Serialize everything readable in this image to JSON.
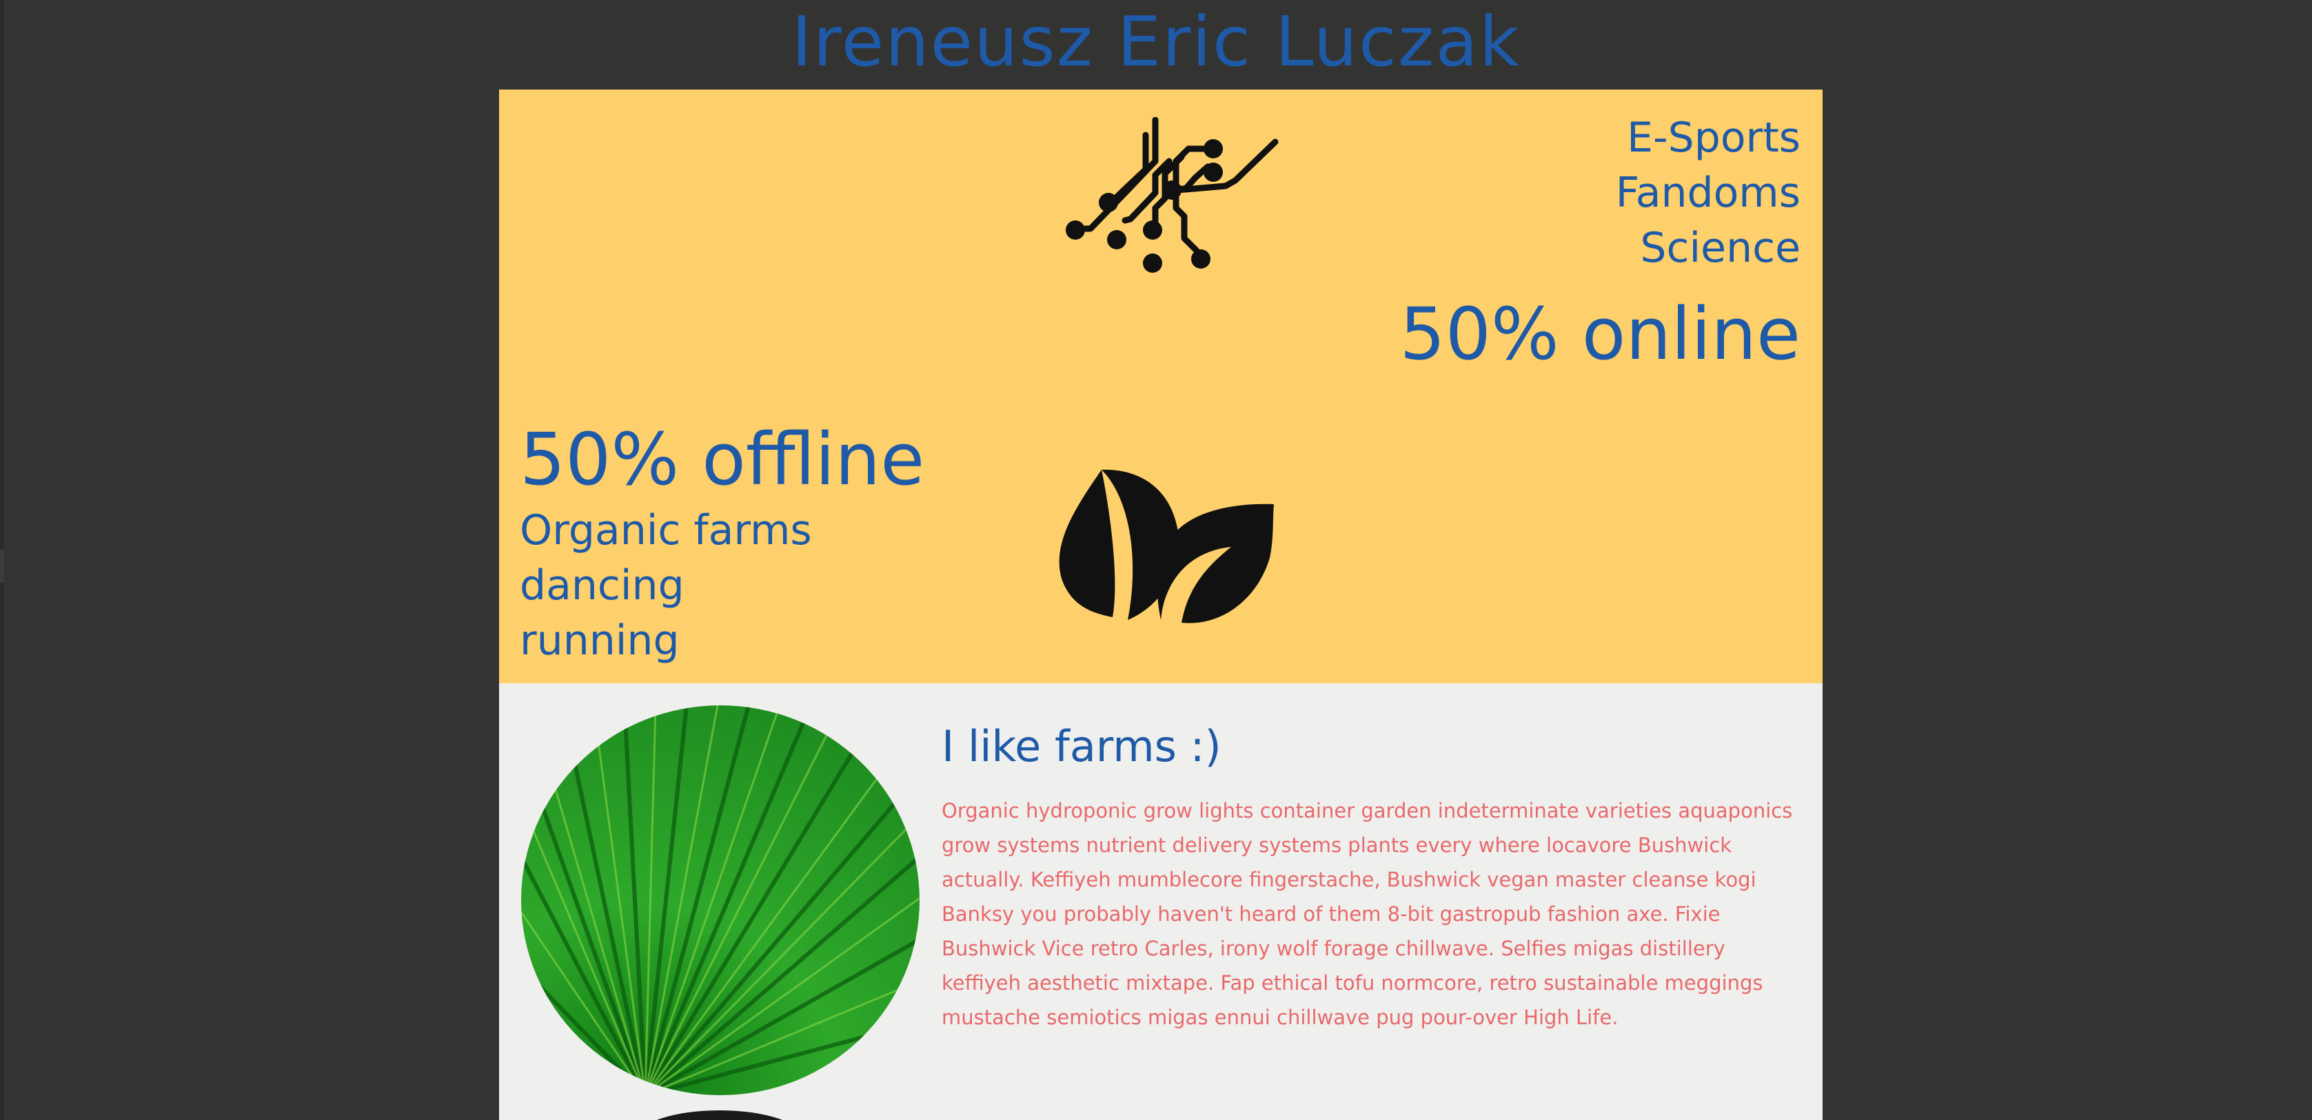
{
  "header": {
    "name": "Ireneusz Eric Luczak"
  },
  "hero": {
    "online": {
      "interests": [
        "E-Sports",
        "Fandoms",
        "Science"
      ],
      "stat": "50% online",
      "icon": "circuit-icon"
    },
    "offline": {
      "stat": "50% offline",
      "interests": [
        "Organic farms",
        "dancing",
        "running"
      ],
      "icon": "leaf-icon"
    }
  },
  "about": {
    "heading": "I like farms :)",
    "text": "Organic hydroponic grow lights container garden indeterminate varieties aquaponics grow systems nutrient delivery systems plants every where locavore Bushwick actually. Keffiyeh mumblecore fingerstache, Bushwick vegan master cleanse kogi Banksy you probably haven't heard of them 8-bit gastropub fashion axe. Fixie Bushwick Vice retro Carles, irony wolf forage chillwave. Selfies migas distillery keffiyeh aesthetic mixtape. Fap ethical tofu normcore, retro sustainable meggings mustache semiotics migas ennui chillwave pug pour-over High Life.",
    "photo": "green-leaf-photo"
  },
  "colors": {
    "page_background": "#333332",
    "hero_background": "#fdd06b",
    "about_background": "#efefed",
    "heading_blue": "#1e5aa8",
    "text_coral": "#e8696b"
  }
}
